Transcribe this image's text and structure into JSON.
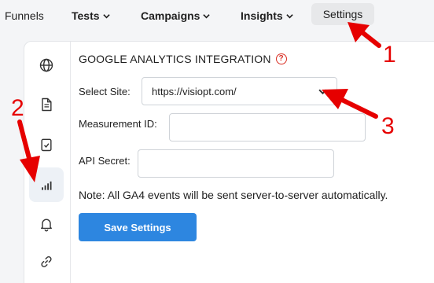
{
  "nav": {
    "funnels": "Funnels",
    "tests": "Tests",
    "campaigns": "Campaigns",
    "insights": "Insights",
    "settings": "Settings"
  },
  "sidebar": {
    "items": [
      {
        "icon": "globe-icon"
      },
      {
        "icon": "document-icon"
      },
      {
        "icon": "clipboard-check-icon"
      },
      {
        "icon": "signal-bars-icon",
        "active": true
      },
      {
        "icon": "bell-icon"
      },
      {
        "icon": "link-icon"
      }
    ]
  },
  "section": {
    "title": "GOOGLE ANALYTICS INTEGRATION",
    "help": "?"
  },
  "form": {
    "site_label": "Select Site:",
    "site_value": "https://visiopt.com/",
    "measurement_label": "Measurement ID:",
    "measurement_value": "",
    "secret_label": "API Secret:",
    "secret_value": "",
    "note": "Note: All GA4 events will be sent server-to-server automatically.",
    "save_label": "Save Settings"
  },
  "annotations": {
    "one": "1",
    "two": "2",
    "three": "3"
  },
  "colors": {
    "accent": "#2d86e0",
    "annotation": "#e60000",
    "help": "#d93025"
  }
}
